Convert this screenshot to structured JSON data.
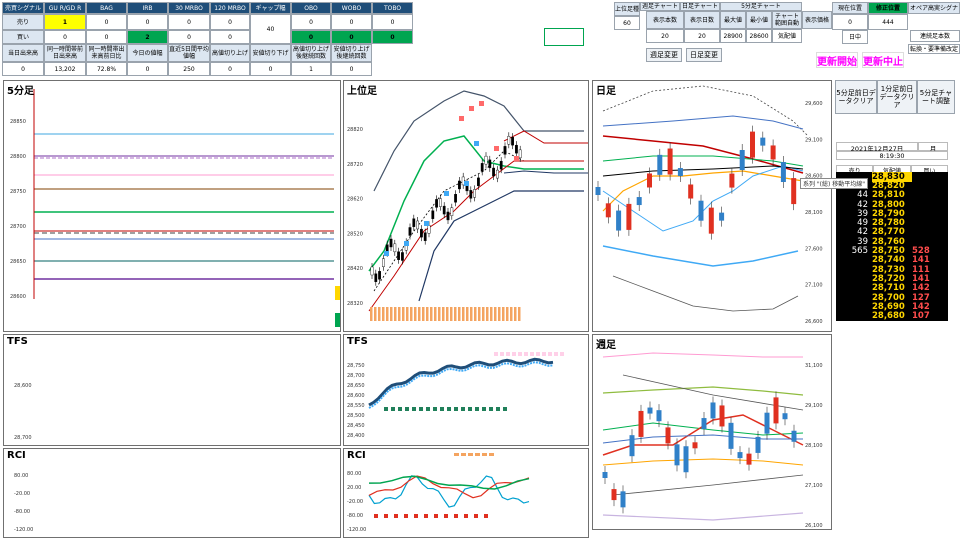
{
  "signal_table": {
    "headers": [
      "売買シグナル",
      "GU R/GD R",
      "BAG",
      "IRB",
      "30 MRBO",
      "120 MRBO",
      "ギャップ幅",
      "OBO",
      "WOBO",
      "TOBO"
    ],
    "row_buy": {
      "label": "売り",
      "values": [
        "1",
        "0",
        "0",
        "0",
        "0",
        "",
        "0",
        "0",
        "0"
      ]
    },
    "row_sell": {
      "label": "買い",
      "values": [
        "0",
        "0",
        "2",
        "0",
        "0",
        "",
        "0",
        "0",
        "0"
      ]
    },
    "gap_value": "40"
  },
  "stats_table": {
    "headers": [
      "当日出来高",
      "同一時間帯前日出来高",
      "同一時間帯出来高前日比",
      "今日の値幅",
      "直近5日間平均値幅",
      "高値切り上げ",
      "安値切り下げ",
      "高値切り上げ後継続回数",
      "安値切り上げ後継続回数"
    ],
    "values": [
      "0",
      "13,202",
      "72.8%",
      "0",
      "250",
      "0",
      "0",
      "1",
      "0"
    ]
  },
  "chart_settings": {
    "upper_label": "上位足種",
    "upper_value": "60",
    "upper_chart": "週足チャート",
    "day_chart": "日足チャート",
    "five_min_chart": "5分足チャート",
    "display_count_label": "表示本数",
    "display_count_value": "20",
    "display_days_label": "表示日数",
    "display_days_value": "20",
    "max_label": "最大値",
    "max_value": "28900",
    "min_label": "最小値",
    "min_value": "28600",
    "chart_drawn_label": "チャート範囲自動",
    "chart_drawn_value": "気配値",
    "display_price_label": "表示価格",
    "current_pos_label": "現在位置",
    "current_pos_value": "0",
    "correct_pos_label": "修正位置",
    "correct_pos_value": "444",
    "day_label": "日中",
    "extra_label": "オペア高実シグナ",
    "continue_label": "連続足本数",
    "switch_label": "転換・要準備改定"
  },
  "buttons": {
    "period_change": "週足変更",
    "day_change": "日足変更",
    "update_start": "更新開始",
    "update_stop": "更新中止",
    "clear_5min": "5分足前日データクリア",
    "clear_1min": "1分足前日データクリア",
    "adjust_5min": "5分足チャート調整"
  },
  "panels": {
    "five_min": "5分足",
    "upper": "上位足",
    "daily": "日足",
    "weekly": "週足",
    "tfs_left": "TFS",
    "tfs_mid": "TFS",
    "rci_left": "RCI",
    "rci_mid": "RCI"
  },
  "datetime": {
    "date": "2021年12月27日",
    "weekday": "月",
    "time": "8:19:30"
  },
  "order_book": {
    "headers": [
      "売り",
      "気配値",
      "買い"
    ],
    "rows": [
      {
        "qty": "",
        "price": "28,830",
        "ask": ""
      },
      {
        "qty": "50",
        "price": "28,820",
        "ask": ""
      },
      {
        "qty": "44",
        "price": "28,810",
        "ask": ""
      },
      {
        "qty": "42",
        "price": "28,800",
        "ask": ""
      },
      {
        "qty": "39",
        "price": "28,790",
        "ask": ""
      },
      {
        "qty": "49",
        "price": "28,780",
        "ask": ""
      },
      {
        "qty": "42",
        "price": "28,770",
        "ask": ""
      },
      {
        "qty": "39",
        "price": "28,760",
        "ask": ""
      },
      {
        "qty": "565",
        "price": "28,750",
        "ask": "528"
      },
      {
        "qty": "",
        "price": "28,740",
        "ask": "141"
      },
      {
        "qty": "",
        "price": "28,730",
        "ask": "111"
      },
      {
        "qty": "",
        "price": "28,720",
        "ask": "141"
      },
      {
        "qty": "",
        "price": "28,710",
        "ask": "142"
      },
      {
        "qty": "",
        "price": "28,700",
        "ask": "127"
      },
      {
        "qty": "",
        "price": "28,690",
        "ask": "142"
      },
      {
        "qty": "",
        "price": "28,680",
        "ask": "107"
      }
    ]
  },
  "axes": {
    "five_min": [
      "28850",
      "28800",
      "28750",
      "28700",
      "28650",
      "28600"
    ],
    "upper": [
      "28820",
      "28720",
      "28620",
      "28520",
      "28420",
      "28320"
    ],
    "daily": [
      "29,600",
      "29,100",
      "28,600",
      "28,100",
      "27,600",
      "27,100",
      "26,600"
    ],
    "weekly": [
      "31,100",
      "29,100",
      "28,100",
      "27,100",
      "26,100"
    ],
    "tfs_left": [
      "28,600",
      "28,700"
    ],
    "tfs_mid": [
      "28,750",
      "28,700",
      "28,650",
      "28,600",
      "28,550",
      "28,500",
      "28,450",
      "28,400"
    ],
    "rci_left": [
      "80.00",
      "-20.00",
      "-80.00",
      "-120.00"
    ],
    "rci_mid": [
      "80.00",
      "20.00",
      "-20.00",
      "-80.00",
      "-120.00"
    ]
  },
  "tooltip": "系列 \"(総) 移動平均線\"",
  "colors": {
    "header": "#1f4e79",
    "yellow": "#ffff00",
    "green": "#00a550",
    "magenta": "#ff00ff"
  }
}
